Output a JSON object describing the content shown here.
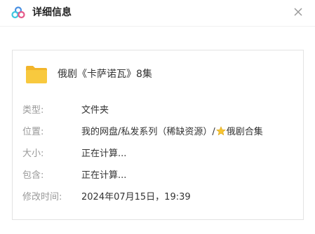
{
  "dialog": {
    "title": "详细信息",
    "logo_icon": "baidu-netdisk-logo-icon",
    "close_icon": "close-icon"
  },
  "file": {
    "icon": "folder-icon",
    "name": "俄剧《卡萨诺瓦》8集"
  },
  "details": {
    "type": {
      "label": "类型:",
      "value": "文件夹"
    },
    "location": {
      "label": "位置:",
      "value_prefix": "我的网盘/私发系列（稀缺资源）/",
      "star_icon": "star-icon",
      "value_suffix": "俄剧合集"
    },
    "size": {
      "label": "大小:",
      "value": "正在计算..."
    },
    "contains": {
      "label": "包含:",
      "value": "正在计算..."
    },
    "modified": {
      "label": "修改时间:",
      "value": "2024年07月15日，19:39"
    }
  },
  "colors": {
    "folder": "#f8c93e",
    "folder_tab": "#f2b52b",
    "star": "#f7c531",
    "label": "#999999",
    "text": "#333333",
    "border": "#e3e3e3"
  }
}
